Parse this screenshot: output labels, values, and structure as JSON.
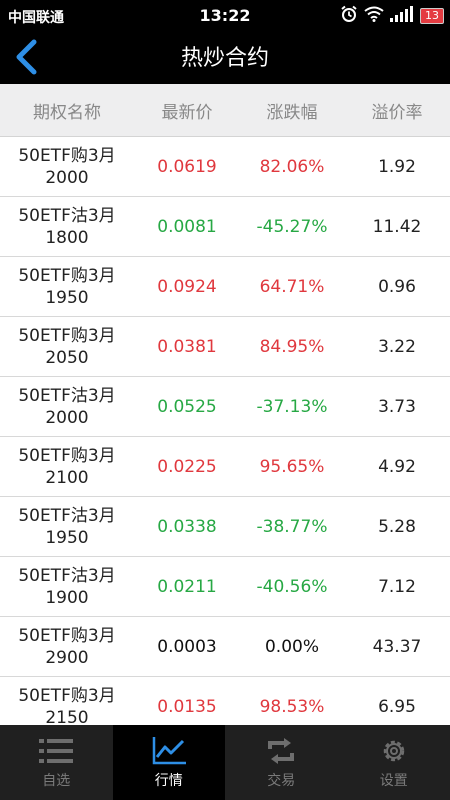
{
  "status_bar": {
    "carrier": "中国联通",
    "time": "13:22",
    "battery": "13"
  },
  "header": {
    "title": "热炒合约"
  },
  "table": {
    "columns": [
      "期权名称",
      "最新价",
      "涨跌幅",
      "溢价率"
    ],
    "rows": [
      {
        "name_line1": "50ETF购3月",
        "name_line2": "2000",
        "price": "0.0619",
        "change": "82.06%",
        "premium": "1.92",
        "trend": "up"
      },
      {
        "name_line1": "50ETF沽3月",
        "name_line2": "1800",
        "price": "0.0081",
        "change": "-45.27%",
        "premium": "11.42",
        "trend": "down"
      },
      {
        "name_line1": "50ETF购3月",
        "name_line2": "1950",
        "price": "0.0924",
        "change": "64.71%",
        "premium": "0.96",
        "trend": "up"
      },
      {
        "name_line1": "50ETF购3月",
        "name_line2": "2050",
        "price": "0.0381",
        "change": "84.95%",
        "premium": "3.22",
        "trend": "up"
      },
      {
        "name_line1": "50ETF沽3月",
        "name_line2": "2000",
        "price": "0.0525",
        "change": "-37.13%",
        "premium": "3.73",
        "trend": "down"
      },
      {
        "name_line1": "50ETF购3月",
        "name_line2": "2100",
        "price": "0.0225",
        "change": "95.65%",
        "premium": "4.92",
        "trend": "up"
      },
      {
        "name_line1": "50ETF沽3月",
        "name_line2": "1950",
        "price": "0.0338",
        "change": "-38.77%",
        "premium": "5.28",
        "trend": "down"
      },
      {
        "name_line1": "50ETF沽3月",
        "name_line2": "1900",
        "price": "0.0211",
        "change": "-40.56%",
        "premium": "7.12",
        "trend": "down"
      },
      {
        "name_line1": "50ETF购3月",
        "name_line2": "2900",
        "price": "0.0003",
        "change": "0.00%",
        "premium": "43.37",
        "trend": "flat"
      },
      {
        "name_line1": "50ETF购3月",
        "name_line2": "2150",
        "price": "0.0135",
        "change": "98.53%",
        "premium": "6.95",
        "trend": "up"
      }
    ]
  },
  "tabs": [
    {
      "label": "自选",
      "icon": "list-icon",
      "active": false
    },
    {
      "label": "行情",
      "icon": "chart-icon",
      "active": true
    },
    {
      "label": "交易",
      "icon": "trade-icon",
      "active": false
    },
    {
      "label": "设置",
      "icon": "gear-icon",
      "active": false
    }
  ],
  "colors": {
    "up": "#e0383e",
    "down": "#27a844",
    "flat": "#111111",
    "accent": "#2e8fe6"
  }
}
